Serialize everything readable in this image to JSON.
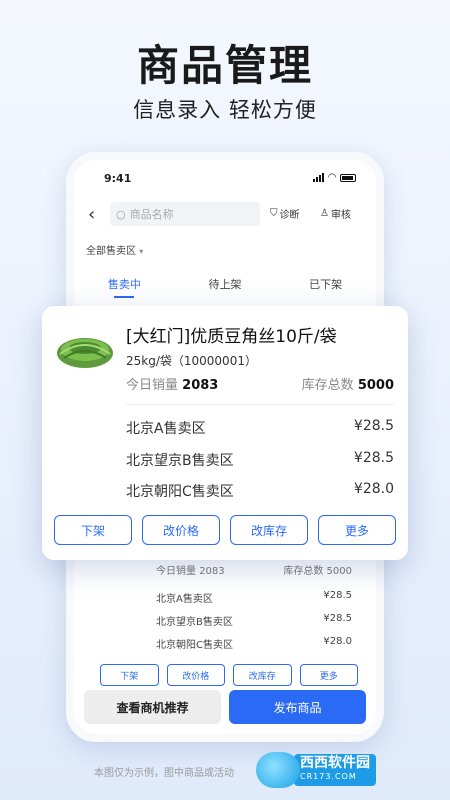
{
  "hero": {
    "title": "商品管理",
    "subtitle": "信息录入 轻松方便"
  },
  "status": {
    "time": "9:41"
  },
  "header": {
    "search_placeholder": "商品名称",
    "diagnose_label": "诊断",
    "review_label": "审核"
  },
  "region_filter": "全部售卖区",
  "tabs": [
    {
      "label": "售卖中",
      "active": true
    },
    {
      "label": "待上架",
      "active": false
    },
    {
      "label": "已下架",
      "active": false
    }
  ],
  "product": {
    "name": "[大红门]优质豆角丝10斤/袋",
    "spec": "25kg/袋（10000001）",
    "today_sales_label": "今日销量",
    "today_sales_value": "2083",
    "stock_label": "库存总数",
    "stock_value": "5000",
    "zones": [
      {
        "name": "北京A售卖区",
        "price": "¥28.5"
      },
      {
        "name": "北京望京B售卖区",
        "price": "¥28.5"
      },
      {
        "name": "北京朝阳C售卖区",
        "price": "¥28.0"
      }
    ],
    "actions": [
      "下架",
      "改价格",
      "改库存",
      "更多"
    ]
  },
  "bottom_buttons": {
    "left": "查看商机推荐",
    "right": "发布商品"
  },
  "footnote": "本图仅为示例，图中商品或活动",
  "watermark": {
    "brand": "西西软件园",
    "domain": "CR173.COM"
  },
  "colors": {
    "accent": "#2b6af5",
    "background": "#e8f0fc"
  }
}
